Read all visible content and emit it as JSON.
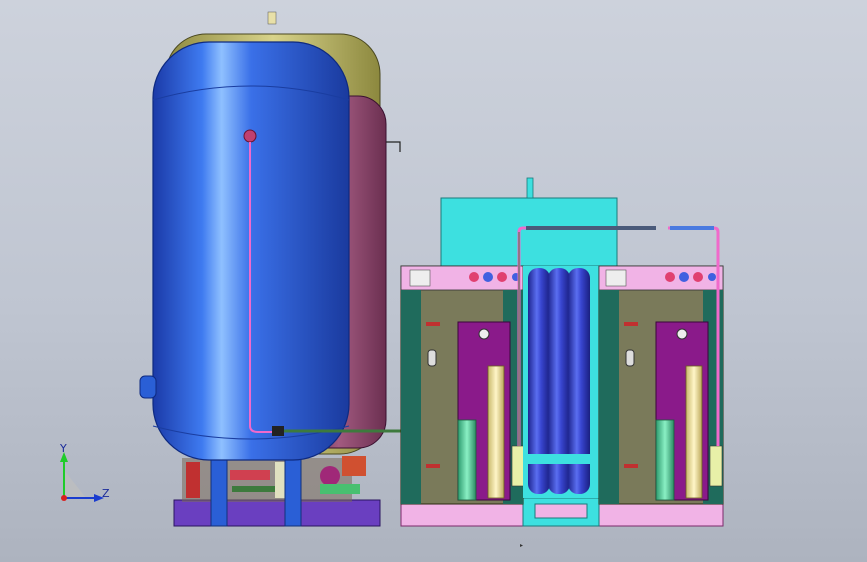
{
  "scene": {
    "background_top": "#cdd2dc",
    "background_bottom": "#adb3bf",
    "model_colors": {
      "main_tank": "#2a5fd6",
      "rear_tank_olive": "#c8c27a",
      "rear_tank_plum": "#8a4468",
      "base_frame": "#6a3fc0",
      "cabinet_panel": "#7a7a5a",
      "cabinet_door": "#8a1a8a",
      "cabinet_side": "#1f6b5c",
      "top_box": "#3de0e0",
      "column_blue": "#3540c8",
      "base_pink": "#f1b3e6",
      "pipe_pink": "#f06acb",
      "pipe_green": "#3d7a3d",
      "cylinder_green": "#56d4a0",
      "cylinder_cream": "#f2e7a3"
    }
  },
  "triad": {
    "y_label": "Y",
    "z_label": "Z",
    "y_color": "#1fcc2a",
    "z_color": "#1a3ccf",
    "origin_color": "#d82020"
  }
}
